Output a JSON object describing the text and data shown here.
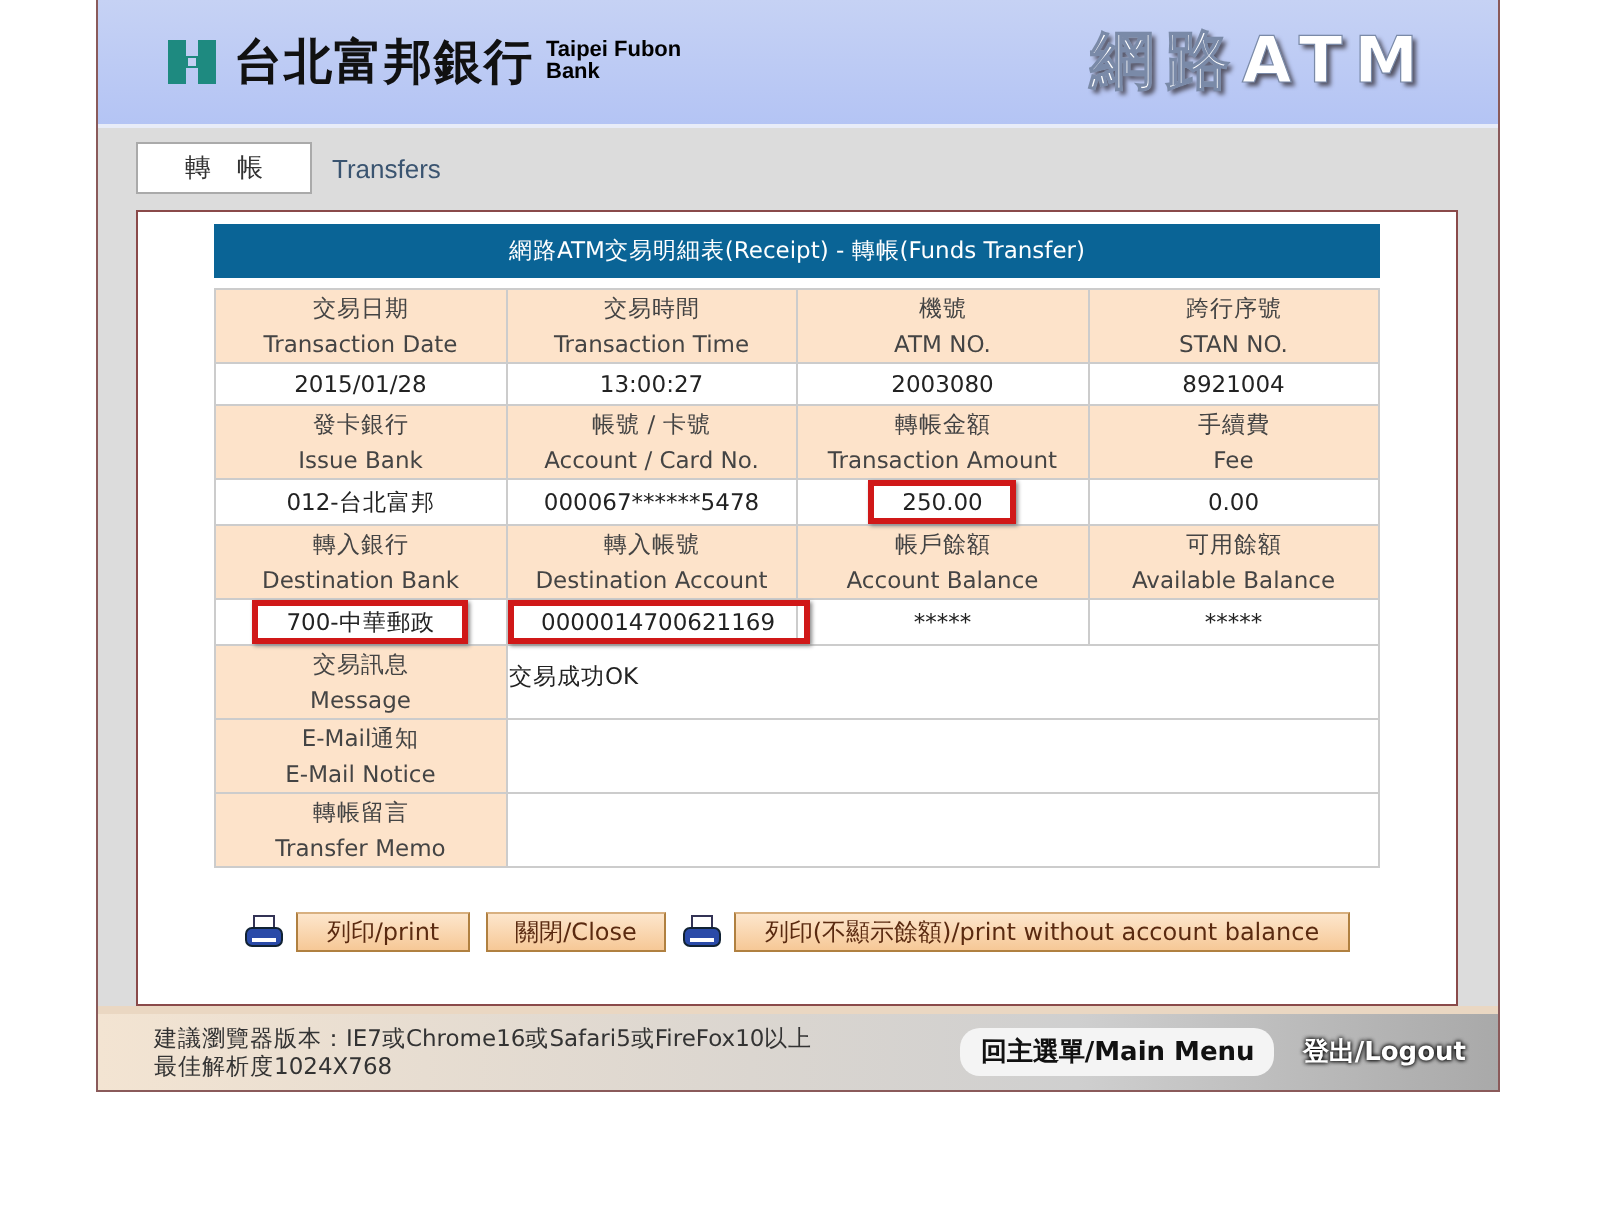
{
  "header": {
    "bank_name": "台北富邦銀行",
    "bank_name_en": [
      "Taipei Fubon",
      "Bank"
    ],
    "service": "網路ATM"
  },
  "tabs": [
    {
      "label": "轉　帳",
      "selected": true
    }
  ],
  "breadcrumb": "Transfers",
  "receipt": {
    "title": "網路ATM交易明細表(Receipt) - 轉帳(Funds Transfer)",
    "grid": [
      {
        "labels": [
          [
            "交易日期",
            "Transaction Date"
          ],
          [
            "交易時間",
            "Transaction Time"
          ],
          [
            "機號",
            "ATM NO."
          ],
          [
            "跨行序號",
            "STAN NO."
          ]
        ],
        "values": [
          {
            "text": "2015/01/28",
            "highlighted": false
          },
          {
            "text": "13:00:27",
            "highlighted": false
          },
          {
            "text": "2003080",
            "highlighted": false
          },
          {
            "text": "8921004",
            "highlighted": false
          }
        ]
      },
      {
        "labels": [
          [
            "發卡銀行",
            "Issue Bank"
          ],
          [
            "帳號 / 卡號",
            "Account / Card No."
          ],
          [
            "轉帳金額",
            "Transaction Amount"
          ],
          [
            "手續費",
            "Fee"
          ]
        ],
        "values": [
          {
            "text": "012-台北富邦",
            "highlighted": false
          },
          {
            "text": "000067******5478",
            "highlighted": false
          },
          {
            "text": "250.00",
            "highlighted": true
          },
          {
            "text": "0.00",
            "highlighted": false
          }
        ]
      },
      {
        "labels": [
          [
            "轉入銀行",
            "Destination Bank"
          ],
          [
            "轉入帳號",
            "Destination Account"
          ],
          [
            "帳戶餘額",
            "Account Balance"
          ],
          [
            "可用餘額",
            "Available Balance"
          ]
        ],
        "values": [
          {
            "text": "700-中華郵政",
            "highlighted": true
          },
          {
            "text": "0000014700621169",
            "highlighted": true
          },
          {
            "text": "*****",
            "highlighted": false
          },
          {
            "text": "*****",
            "highlighted": false
          }
        ]
      }
    ],
    "details": [
      {
        "label": [
          "交易訊息",
          "Message"
        ],
        "value": "交易成功OK"
      },
      {
        "label": [
          "E-Mail通知",
          "E-Mail Notice"
        ]
      },
      {
        "label": [
          "轉帳留言",
          "Transfer Memo"
        ]
      }
    ]
  },
  "actions": [
    {
      "label": "列印/print",
      "printer": true
    },
    {
      "label": "關閉/Close",
      "printer": false
    },
    {
      "label": "列印(不顯示餘額)/print without account balance",
      "printer": true
    }
  ],
  "footer": {
    "notes": [
      "建議瀏覽器版本：IE7或Chrome16或Safari5或FireFox10以上",
      "最佳解析度1024X768"
    ],
    "main_menu": "回主選單/Main Menu",
    "logout": "登出/Logout"
  }
}
